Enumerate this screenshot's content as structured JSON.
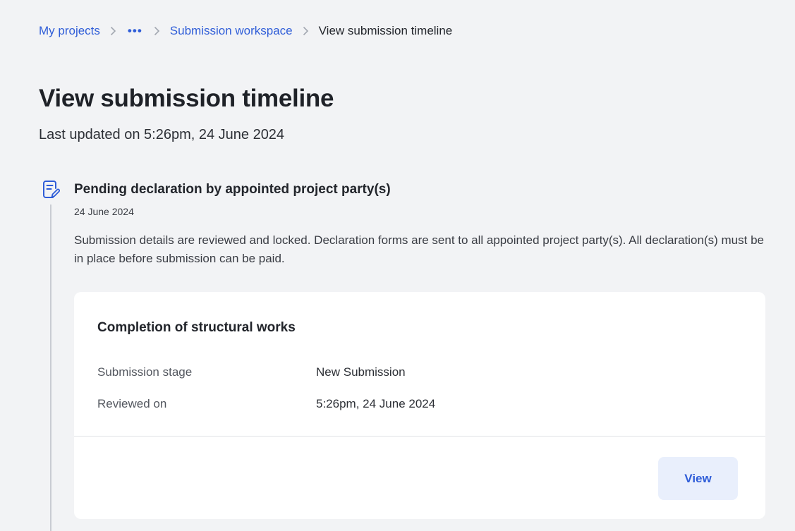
{
  "breadcrumb": {
    "items": [
      "My projects",
      "Submission workspace"
    ],
    "more": "•••",
    "current": "View submission timeline"
  },
  "page": {
    "title": "View submission timeline",
    "last_updated": "Last updated on 5:26pm, 24 June 2024"
  },
  "timeline": {
    "event": {
      "icon": "document-edit-icon",
      "title": "Pending declaration by appointed project party(s)",
      "date": "24 June 2024",
      "description": "Submission details are reviewed and locked. Declaration forms are sent to all appointed project party(s). All declaration(s) must be in place before submission can be paid."
    }
  },
  "card": {
    "title": "Completion of structural works",
    "rows": [
      {
        "label": "Submission stage",
        "value": "New Submission"
      },
      {
        "label": "Reviewed on",
        "value": "5:26pm, 24 June 2024"
      }
    ],
    "view_label": "View"
  },
  "colors": {
    "accent": "#2f5dd8",
    "background": "#f2f3f5",
    "button_bg": "#e9effc"
  }
}
